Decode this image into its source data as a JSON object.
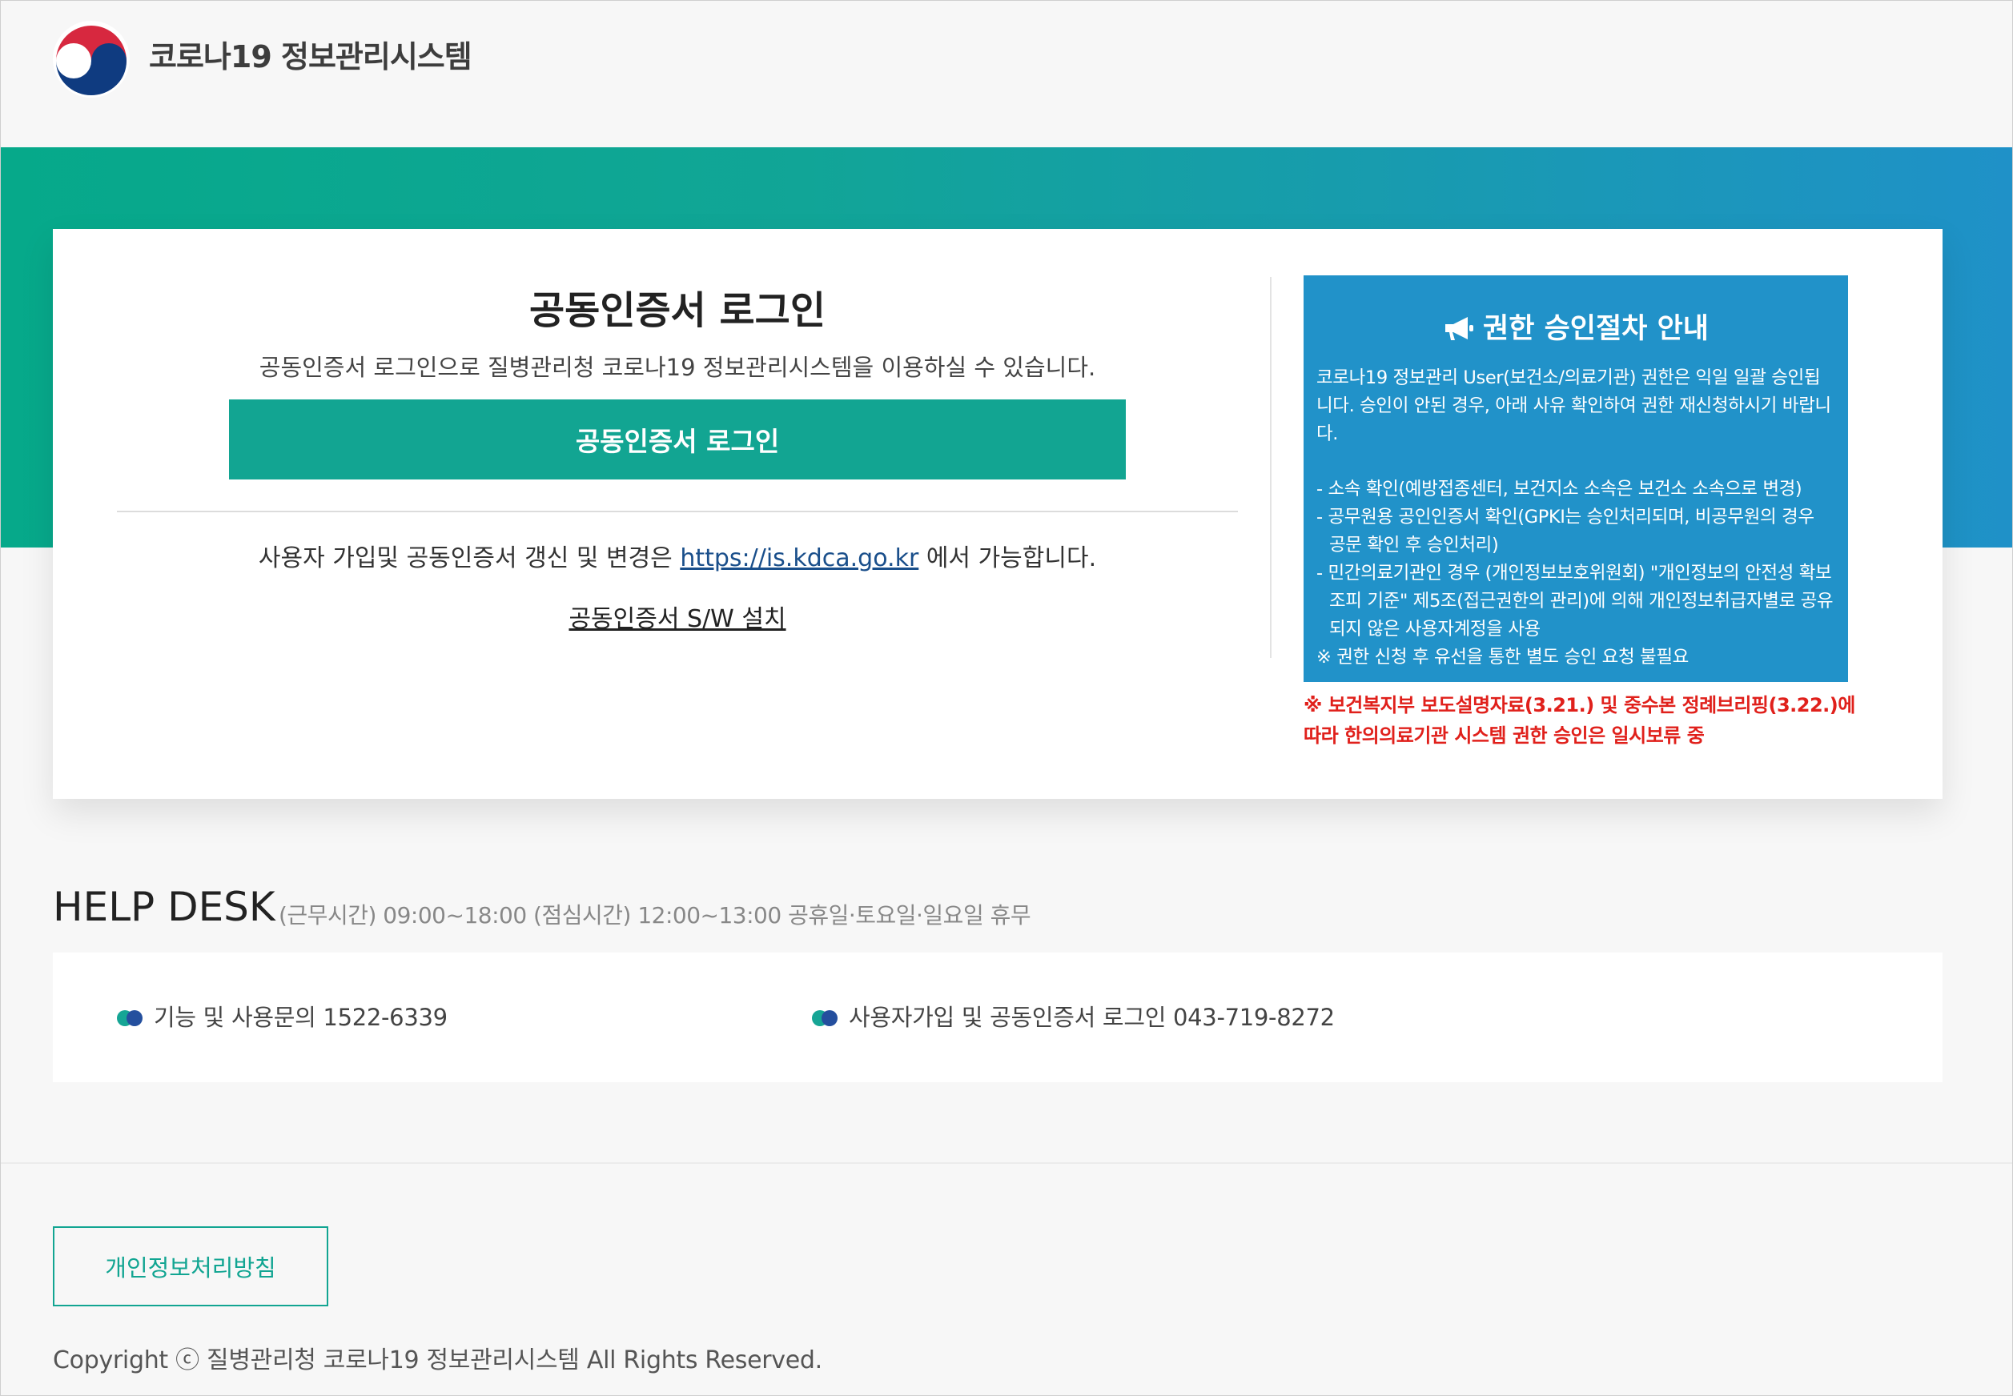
{
  "header": {
    "site_title": "코로나19 정보관리시스템"
  },
  "login": {
    "title": "공동인증서 로그인",
    "description": "공동인증서 로그인으로 질병관리청 코로나19 정보관리시스템을 이용하실 수 있습니다.",
    "button_label": "공동인증서 로그인",
    "signup_prefix": "사용자 가입및 공동인증서 갱신 및 변경은 ",
    "signup_link": "https://is.kdca.go.kr",
    "signup_suffix": " 에서 가능합니다.",
    "sw_install_label": "공동인증서 S/W 설치"
  },
  "notice": {
    "icon": "megaphone-icon",
    "title": "권한 승인절차 안내",
    "paragraph": "코로나19 정보관리 User(보건소/의료기관) 권한은 익일 일괄 승인됩니다. 승인이 안된 경우, 아래 사유 확인하여 권한 재신청하시기 바랍니다.",
    "items": [
      "- 소속 확인(예방접종센터, 보건지소 소속은 보건소 소속으로 변경)",
      "- 공무원용 공인인증서 확인(GPKI는 승인처리되며, 비공무원의 경우 공문 확인 후 승인처리)",
      "- 민간의료기관인 경우 (개인정보보호위원회) \"개인정보의 안전성 확보조피 기준\" 제5조(접근권한의 관리)에 의해 개인정보취급자별로 공유되지 않은 사용자계정을 사용"
    ],
    "reference": "※ 권한 신청 후 유선을 통한 별도 승인 요청 불필요",
    "warning": "※ 보건복지부 보도설명자료(3.21.) 및 중수본 정례브리핑(3.22.)에 따라 한의의료기관 시스템 권한 승인은 일시보류 중"
  },
  "helpdesk": {
    "title": "HELP DESK",
    "hours": "(근무시간) 09:00~18:00 (점심시간) 12:00~13:00 공휴일·토요일·일요일 휴무",
    "contacts": [
      "기능 및 사용문의 1522-6339",
      "사용자가입 및 공동인증서 로그인 043-719-8272"
    ]
  },
  "footer": {
    "privacy_label": "개인정보처리방침",
    "copyright": "Copyright ⓒ 질병관리청 코로나19 정보관리시스템 All Rights Reserved."
  },
  "colors": {
    "accent_green": "#12a592",
    "accent_blue": "#2192c9",
    "warning_red": "#e0201b",
    "link_blue": "#1a4f8b"
  }
}
